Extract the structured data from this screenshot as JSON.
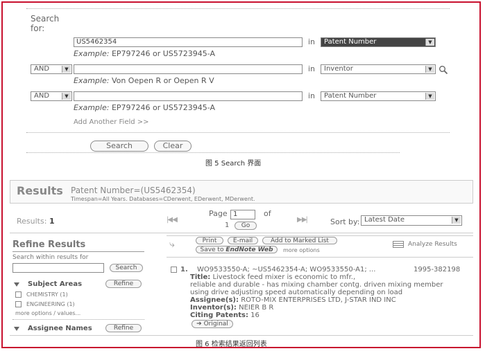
{
  "search_form": {
    "search_for_label": "Search for:",
    "rows": [
      {
        "operator": "",
        "value": "US5462354",
        "in_label": "in",
        "field": "Patent Number",
        "example": "EP797246 or US5723945-A"
      },
      {
        "operator": "AND",
        "value": "",
        "in_label": "in",
        "field": "Inventor",
        "example": "Von Oepen R or Oepen R V"
      },
      {
        "operator": "AND",
        "value": "",
        "in_label": "in",
        "field": "Patent Number",
        "example": "EP797246 or US5723945-A"
      }
    ],
    "example_prefix": "Example:",
    "add_field_link": "Add Another Field >>",
    "search_button": "Search",
    "clear_button": "Clear",
    "caption": "图 5   Search 界面"
  },
  "results": {
    "title": "Results",
    "query": "Patent Number=(US5462354)",
    "timespan": "Timespan=All Years. Databases=CDerwent, EDerwent, MDerwent.",
    "results_label": "Results:",
    "results_count": "1",
    "page_label": "Page",
    "page_value": "1",
    "of_label": "of",
    "total_pages": "1",
    "go_button": "Go",
    "sort_label": "Sort by:",
    "sort_value": "Latest Date",
    "toolbar": {
      "print": "Print",
      "email": "E-mail",
      "add_marked": "Add to Marked List",
      "save_prefix": "Save to",
      "save_endnote": "EndNote Web",
      "more_options": "more options",
      "analyze": "Analyze Results"
    },
    "refine": {
      "title": "Refine Results",
      "search_within_label": "Search within results for",
      "search_button": "Search",
      "subject_areas_label": "Subject Areas",
      "refine_button": "Refine",
      "subjects": [
        "CHEMISTRY (1)",
        "ENGINEERING (1)"
      ],
      "more_options": "more options / values...",
      "assignee_label": "Assignee Names",
      "assignee_refine_button": "Refine"
    },
    "record": {
      "number": "1.",
      "ids": "WO9533550-A; ~US5462354-A; WO9533550-A1; ...",
      "accession": "1995-382198",
      "title_label": "Title:",
      "title_lines": [
        "Livestock feed mixer is economic to mfr.,",
        "reliable and durable - has mixing chamber contg. driven mixing member",
        "using drive adjusting speed automatically depending on load"
      ],
      "assignee_label": "Assignee(s):",
      "assignee_value": "ROTO-MIX ENTERPRISES LTD, J-STAR IND INC",
      "inventor_label": "Inventor(s):",
      "inventor_value": "NEIER B R",
      "citing_label": "Citing Patents:",
      "citing_value": "16",
      "original_button": "Original"
    },
    "caption": "图 6   检索结果返回列表"
  }
}
